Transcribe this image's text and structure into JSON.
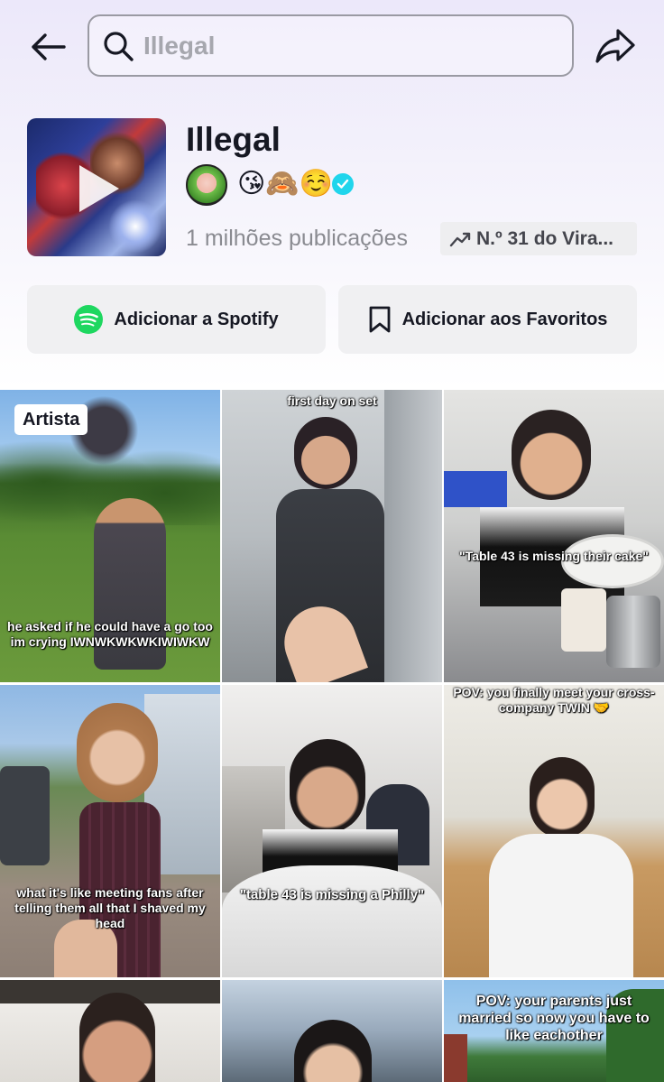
{
  "header": {
    "search_value": "Illegal"
  },
  "sound": {
    "title": "Illegal",
    "artist_emojis": "😘🙈☺️",
    "post_count": "1 milhões publicações",
    "rank_label": "N.º 31 do Vira..."
  },
  "actions": {
    "spotify_label": "Adicionar a Spotify",
    "favorites_label": "Adicionar aos Favoritos"
  },
  "grid": {
    "artist_badge": "Artista",
    "videos": [
      {
        "caption": "he asked if he could have a go too im crying IWNWKWKWKIWIWKW"
      },
      {
        "caption": "first day on set"
      },
      {
        "caption": "\"Table 43 is missing their cake\""
      },
      {
        "caption": "what it's like meeting fans after telling them all that I shaved my head"
      },
      {
        "caption": "\"table 43 is missing a Philly\""
      },
      {
        "caption": "POV: you finally meet your cross-company TWIN 🤝"
      },
      {
        "caption": ""
      },
      {
        "caption": ""
      },
      {
        "caption": "POV: your parents just married so now you have to like eachother"
      }
    ]
  }
}
